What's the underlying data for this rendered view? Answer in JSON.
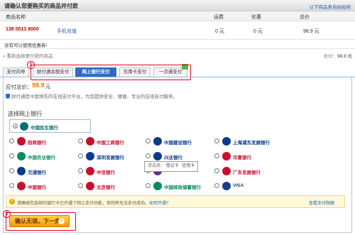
{
  "header": {
    "title": "请确认您要购买的商品并付款",
    "link": "以下商品来自拍拍网"
  },
  "table": {
    "columns": [
      "商品名称",
      "运费",
      "优惠",
      "总价"
    ],
    "row": {
      "phone": "138 0013 8000",
      "type": "手机充值",
      "shipping": "0 元",
      "discount": "0 元",
      "total": "98.9 元"
    }
  },
  "note": "没有可以使用优惠券!",
  "reselect": "重新选择要付款的商品",
  "total_line": {
    "label": "合计：",
    "value": "98.9 元"
  },
  "tabs": [
    {
      "label": "支付向导",
      "active": false
    },
    {
      "label": "财付通余额支付",
      "active": false
    },
    {
      "label": "网上银行支付",
      "active": true
    },
    {
      "label": "信用卡支付",
      "active": false
    },
    {
      "label": "一点通支付",
      "active": false
    }
  ],
  "markers": {
    "step1": "1",
    "step2": "2"
  },
  "payment": {
    "amount_label": "应付总价：",
    "amount": "98.9",
    "amount_unit": "元",
    "secure_note": "财付通是中国领先的在线支付平台，为您提供安全、便捷、专业的在线支付服务。"
  },
  "bank_section": {
    "title": "选择网上银行",
    "selected": "中国民生银行",
    "banks": [
      {
        "name": "招商银行",
        "color": "#c8102e"
      },
      {
        "name": "中国工商银行",
        "color": "#c8102e"
      },
      {
        "name": "中国建设银行",
        "color": "#0b3c8c"
      },
      {
        "name": "上海浦东发展银行",
        "color": "#0b3c8c"
      },
      {
        "name": "中国农业银行",
        "color": "#0a8a5a"
      },
      {
        "name": "深圳发展银行",
        "color": "#0b3c8c"
      },
      {
        "name": "兴业银行",
        "color": "#0b3c8c"
      },
      {
        "name": "华夏银行",
        "color": "#c8102e"
      },
      {
        "name": "交通银行",
        "color": "#0b3c8c"
      },
      {
        "name": "中信银行",
        "color": "#c8102e"
      },
      {
        "name": "CEB",
        "color": "#6a2c8c"
      },
      {
        "name": "广东发展银行",
        "color": "#c8102e"
      },
      {
        "name": "中国银行",
        "color": "#c8102e"
      },
      {
        "name": "北京银行",
        "color": "#c8102e"
      },
      {
        "name": "中国邮政储蓄银行",
        "color": "#0a8a5a"
      },
      {
        "name": "VISA",
        "color": "#1a3d8f"
      }
    ],
    "tooltip": {
      "label": "请选择：",
      "opt1": "借记卡",
      "opt2": "信用卡"
    }
  },
  "notice": {
    "text": "请确保您选择的银行卡已开通了网上支付功能，否则将无法支付成功。",
    "link": "如何开通?",
    "right_link": "查看支付限额"
  },
  "confirm_button": {
    "label": "确认无误，下一步",
    "arrow": "›"
  }
}
